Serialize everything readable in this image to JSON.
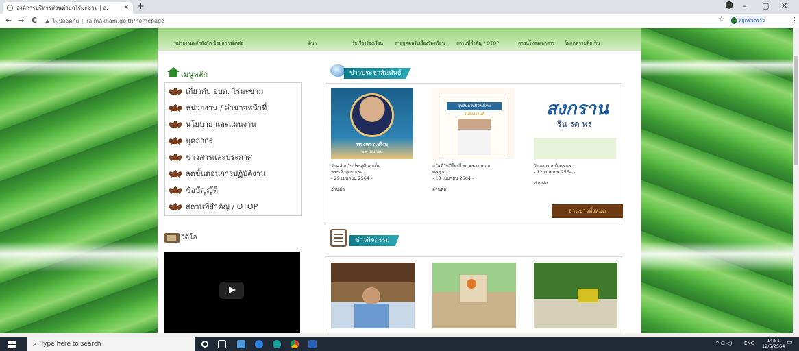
{
  "browser": {
    "tab_title": "องค์การบริหารส่วนตำบลไร่มะขาม | อ.",
    "tab_close": "×",
    "new_tab": "+",
    "window_controls": {
      "minimize": "–",
      "maximize": "▢",
      "close": "✕"
    },
    "nav": {
      "back": "←",
      "forward": "→",
      "reload": "C"
    },
    "security_label": "ไม่ปลอดภัย",
    "url": "raimakham.go.th/homepage",
    "star": "☆",
    "profile_label": "หยุดชั่วคราว",
    "menu_dots": "⋮"
  },
  "top_nav": {
    "items": [
      "หน่วยงานหลักสังกัด  ข้อมูลการติดต่อ",
      "อื่นๆ",
      "รับเรื่องร้องเรียน",
      "สายบุคคลรับเรื่องร้องเรียน",
      "สถานที่สำคัญ / OTOP",
      "ดาวน์โหลดเอกสาร",
      "โหลดความคิดเห็น"
    ]
  },
  "main_menu": {
    "title": "เมนูหลัก",
    "items": [
      "เกี่ยวกับ อบต. ไร่มะขาม",
      "หน่วยงาน / อำนาจหน้าที่",
      "นโยบาย และแผนงาน",
      "บุคลากร",
      "ข่าวสารและประกาศ",
      "ลดขั้นตอนการปฏิบัติงาน",
      "ข้อบัญญัติ",
      "สถานที่สำคัญ / OTOP"
    ]
  },
  "video_section": {
    "title": "วีดีโอ"
  },
  "news_section": {
    "title": "ข่าวประชาสัมพันธ์",
    "cards": [
      {
        "caption_1": "วันคล้ายวันประสูติ สมเด็จ",
        "caption_2": "พระเจ้าลูกยาเธอ...",
        "date": "- 29 เมษายน 2564 -",
        "read_more": "อ่านต่อ",
        "image_text_1": "ทรงพระเจริญ",
        "image_text_2": "๒๙ เมษายน"
      },
      {
        "caption_1": "สวัสดีวันปีใหม่ไทย ๑๓ เมษายน",
        "caption_2": "๒๕๖๔...",
        "date": "- 13 เมษายน 2564 -",
        "read_more": "อ่านต่อ",
        "image_text_1": "สุขสันต์วันปีใหม่ไทย",
        "image_text_2": "วันสงกรานต์"
      },
      {
        "caption_1": "วันสงกรานต์ ๒๕๖๔...",
        "caption_2": "",
        "date": "- 12 เมษายน 2564 -",
        "read_more": "อ่านต่อ",
        "image_text_1": "สงกราน",
        "image_text_2": "รีน รด พร"
      }
    ],
    "read_all": "อ่านข่าวทั้งหมด"
  },
  "activity_section": {
    "title": "ข่าวกิจกรรม"
  },
  "taskbar": {
    "search_placeholder": "Type here to search",
    "lang": "ENG",
    "time": "14:51",
    "date": "12/5/2564",
    "tray_icons": "^ ⊡ ◁)"
  }
}
